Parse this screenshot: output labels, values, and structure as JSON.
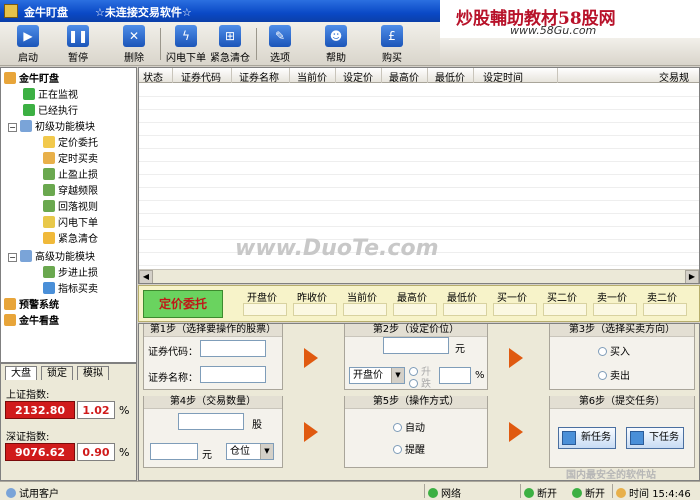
{
  "window": {
    "title": "金牛盯盘",
    "subtitle": "☆未连接交易软件☆"
  },
  "watermark": {
    "brand": "炒股輔助教材58股网",
    "url": "www.58Gu.com",
    "center": "www.DuoTe.com",
    "bottom": "国内最安全的软件站"
  },
  "toolbar": {
    "buttons": [
      {
        "label": "启动",
        "icon": "play-icon"
      },
      {
        "label": "暂停",
        "icon": "pause-icon"
      },
      {
        "label": "删除",
        "icon": "delete-icon"
      },
      {
        "label": "闪电下单",
        "icon": "lightning-icon"
      },
      {
        "label": "紧急清仓",
        "icon": "cart-icon"
      },
      {
        "label": "选项",
        "icon": "wrench-icon"
      },
      {
        "label": "帮助",
        "icon": "user-icon"
      },
      {
        "label": "购买",
        "icon": "pound-icon"
      }
    ]
  },
  "tree": {
    "root": "金牛盯盘",
    "running": "正在监视",
    "executed": "已经执行",
    "basic_group": "初级功能模块",
    "basic_items": [
      "定价委托",
      "定时买卖",
      "止盈止损",
      "穿越频限",
      "回落视则",
      "闪电下单",
      "紧急清仓"
    ],
    "advanced_group": "高级功能模块",
    "advanced_items": [
      "步进止损",
      "指标买卖"
    ],
    "alert": "预警系统",
    "watch": "金牛看盘"
  },
  "index_panel": {
    "tabs": [
      "大盘",
      "锁定",
      "模拟"
    ],
    "sh_label": "上证指数:",
    "sh_value": "2132.80",
    "sh_change": "1.02",
    "sz_label": "深证指数:",
    "sz_value": "9076.62",
    "sz_change": "0.90",
    "pct": "%"
  },
  "grid": {
    "columns": [
      "状态",
      "证券代码",
      "证券名称",
      "当前价",
      "设定价",
      "最高价",
      "最低价",
      "设定时间",
      "交易规"
    ]
  },
  "quote": {
    "entrust_label": "定价委托",
    "headers": [
      "开盘价",
      "昨收价",
      "当前价",
      "最高价",
      "最低价",
      "买一价",
      "买二价",
      "卖一价",
      "卖二价"
    ]
  },
  "steps": {
    "s1": {
      "title": "第1步（选择要操作的股票）",
      "code_label": "证券代码：",
      "name_label": "证券名称："
    },
    "s2": {
      "title": "第2步（设定价位）",
      "unit": "元",
      "select": "开盘价",
      "opt_up": "升",
      "opt_down": "跌",
      "pct": "%"
    },
    "s3": {
      "title": "第3步（选择买卖方向）",
      "buy": "买入",
      "sell": "卖出"
    },
    "s4": {
      "title": "第4步（交易数量）",
      "shares_unit": "股",
      "money_unit": "元",
      "position_select": "仓位"
    },
    "s5": {
      "title": "第5步（操作方式）",
      "auto": "自动",
      "remind": "提醒"
    },
    "s6": {
      "title": "第6步（提交任务）",
      "new_task": "新任务",
      "submit": "下任务"
    }
  },
  "statusbar": {
    "user": "试用客户",
    "network": "网络",
    "disconnect1": "断开",
    "disconnect2": "断开",
    "time_label": "时间",
    "time": "15:4:46"
  }
}
